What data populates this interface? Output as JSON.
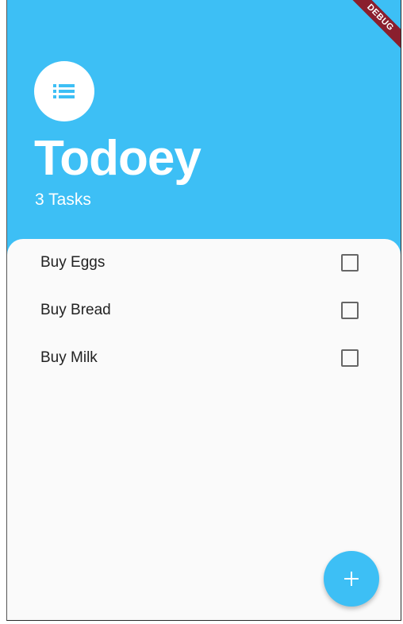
{
  "header": {
    "title": "Todoey",
    "task_count": "3 Tasks",
    "logo_icon": "list-icon"
  },
  "debug_banner": "DEBUG",
  "tasks": [
    {
      "label": "Buy Eggs",
      "checked": false
    },
    {
      "label": "Buy Bread",
      "checked": false
    },
    {
      "label": "Buy Milk",
      "checked": false
    }
  ],
  "fab": {
    "icon": "add-icon"
  },
  "colors": {
    "accent": "#3dbff5",
    "sheet": "#fafafa",
    "banner": "#8a1f2e"
  }
}
